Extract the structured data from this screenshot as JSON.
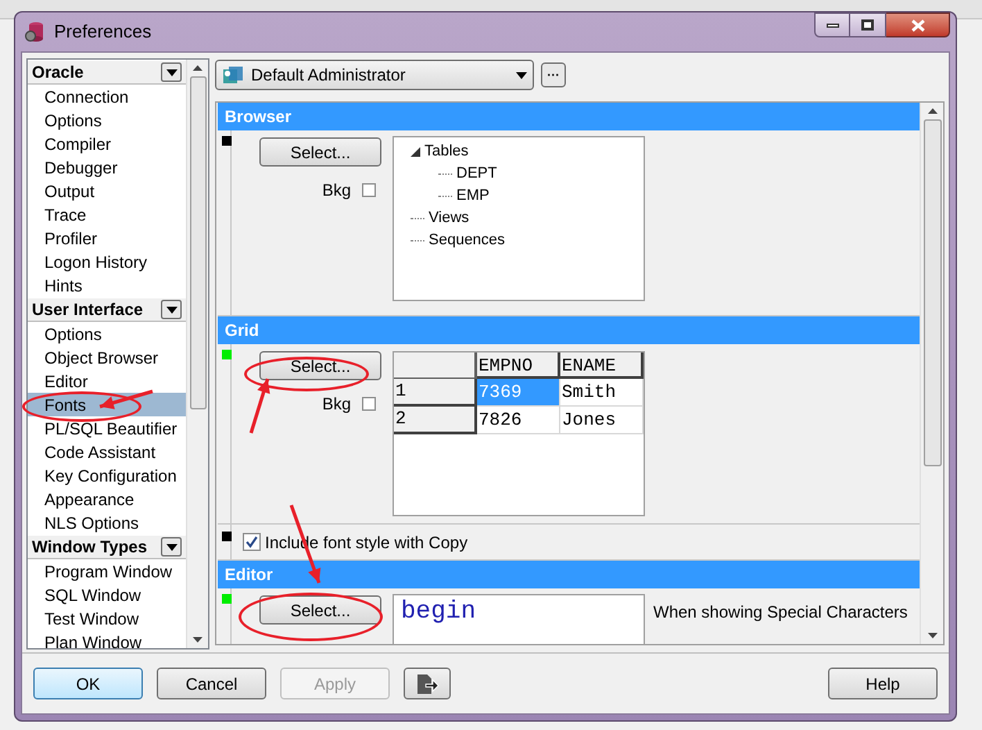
{
  "window": {
    "title": "Preferences"
  },
  "sidebar": {
    "groups": [
      {
        "title": "Oracle",
        "items": [
          {
            "label": "Connection",
            "selected": false
          },
          {
            "label": "Options",
            "selected": false
          },
          {
            "label": "Compiler",
            "selected": false
          },
          {
            "label": "Debugger",
            "selected": false
          },
          {
            "label": "Output",
            "selected": false
          },
          {
            "label": "Trace",
            "selected": false
          },
          {
            "label": "Profiler",
            "selected": false
          },
          {
            "label": "Logon History",
            "selected": false
          },
          {
            "label": "Hints",
            "selected": false
          }
        ]
      },
      {
        "title": "User Interface",
        "items": [
          {
            "label": "Options",
            "selected": false
          },
          {
            "label": "Object Browser",
            "selected": false
          },
          {
            "label": "Editor",
            "selected": false
          },
          {
            "label": "Fonts",
            "selected": true
          },
          {
            "label": "PL/SQL Beautifier",
            "selected": false
          },
          {
            "label": "Code Assistant",
            "selected": false
          },
          {
            "label": "Key Configuration",
            "selected": false
          },
          {
            "label": "Appearance",
            "selected": false
          },
          {
            "label": "NLS Options",
            "selected": false
          }
        ]
      },
      {
        "title": "Window Types",
        "items": [
          {
            "label": "Program Window",
            "selected": false
          },
          {
            "label": "SQL Window",
            "selected": false
          },
          {
            "label": "Test Window",
            "selected": false
          },
          {
            "label": "Plan Window",
            "selected": false
          }
        ]
      }
    ]
  },
  "profile": {
    "value": "Default Administrator",
    "more": "···"
  },
  "browser": {
    "title": "Browser",
    "color": "#000000",
    "button": "Select...",
    "bkg": {
      "label": "Bkg",
      "checked": false
    },
    "tree": [
      {
        "label": "Tables",
        "expanded": true,
        "children": [
          {
            "label": "DEPT"
          },
          {
            "label": "EMP"
          }
        ]
      },
      {
        "label": "Views"
      },
      {
        "label": "Sequences"
      }
    ]
  },
  "grid": {
    "title": "Grid",
    "color": "#00ee00",
    "button": "Select...",
    "bkg": {
      "label": "Bkg",
      "checked": false
    },
    "columns": [
      "EMPNO",
      "ENAME"
    ],
    "rows": [
      {
        "header": "1",
        "cells": [
          {
            "text": "7369",
            "selected": true
          },
          {
            "text": "Smith",
            "selected": false
          }
        ]
      },
      {
        "header": "2",
        "cells": [
          {
            "text": "7826",
            "selected": false
          },
          {
            "text": "Jones",
            "selected": false
          }
        ]
      }
    ]
  },
  "copy_option": {
    "label": "Include font style with Copy",
    "checked": true,
    "color": "#000000"
  },
  "editor": {
    "title": "Editor",
    "color": "#00ee00",
    "button": "Select...",
    "sample": "begin",
    "note": "When showing Special Characters"
  },
  "buttons": [
    {
      "label": "OK",
      "kind": "default",
      "disabled": false
    },
    {
      "label": "Cancel",
      "kind": "normal",
      "disabled": false
    },
    {
      "label": "Apply",
      "kind": "normal",
      "disabled": true
    },
    {
      "kind": "icon",
      "disabled": false
    },
    {
      "label": "Help",
      "kind": "help",
      "disabled": false
    }
  ]
}
